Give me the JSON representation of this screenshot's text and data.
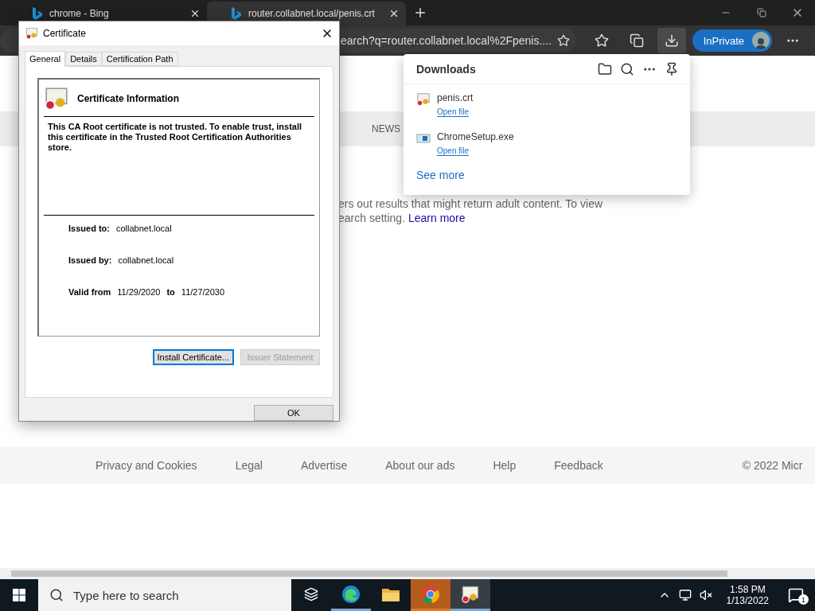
{
  "browser": {
    "tabs": [
      {
        "title": "chrome - Bing",
        "selected": false
      },
      {
        "title": "router.collabnet.local/penis.crt",
        "selected": true
      }
    ],
    "address": "earch?q=router.collabnet.local%2Fpenis....",
    "downloads_open": true,
    "profile_label": "InPrivate"
  },
  "page": {
    "nav": [
      "NEWS"
    ],
    "notice": [
      "ers out results that might return adult content. To view",
      "earch setting."
    ],
    "learn_more": "Learn more",
    "footer_links": [
      "Privacy and Cookies",
      "Legal",
      "Advertise",
      "About our ads",
      "Help",
      "Feedback"
    ],
    "copyright": "© 2022 Micr"
  },
  "downloads": {
    "title": "Downloads",
    "see_more": "See more",
    "items": [
      {
        "name": "penis.crt",
        "action": "Open file",
        "kind": "certificate"
      },
      {
        "name": "ChromeSetup.exe",
        "action": "Open file",
        "kind": "installer"
      }
    ]
  },
  "dialog": {
    "title": "Certificate",
    "tabs": [
      {
        "label": "General",
        "selected": true
      },
      {
        "label": "Details",
        "selected": false
      },
      {
        "label": "Certification Path",
        "selected": false
      }
    ],
    "heading": "Certificate Information",
    "message": "This CA Root certificate is not trusted. To enable trust, install this certificate in the Trusted Root Certification Authorities store.",
    "fields": [
      {
        "label": "Issued to:",
        "value": "collabnet.local"
      },
      {
        "label": "Issued by:",
        "value": "collabnet.local"
      }
    ],
    "validity": {
      "label": "Valid from",
      "from": "11/29/2020",
      "to_label": "to",
      "to": "11/27/2030"
    },
    "buttons": [
      {
        "label": "Install Certificate...",
        "disabled": false,
        "focused": true
      },
      {
        "label": "Issuer Statement",
        "disabled": true,
        "focused": false
      }
    ],
    "ok": "OK"
  },
  "taskbar": {
    "search_placeholder": "Type here to search",
    "apps": [
      {
        "kind": "taskview",
        "running": false,
        "flashing": false,
        "selected": false
      },
      {
        "kind": "edge",
        "running": true,
        "flashing": false,
        "selected": false
      },
      {
        "kind": "folder",
        "running": false,
        "flashing": false,
        "selected": false
      },
      {
        "kind": "chrome",
        "running": true,
        "flashing": true,
        "selected": false
      },
      {
        "kind": "certificate",
        "running": true,
        "flashing": false,
        "selected": true
      }
    ],
    "time": "1:58 PM",
    "date": "1/13/2022",
    "notifications": "1"
  }
}
